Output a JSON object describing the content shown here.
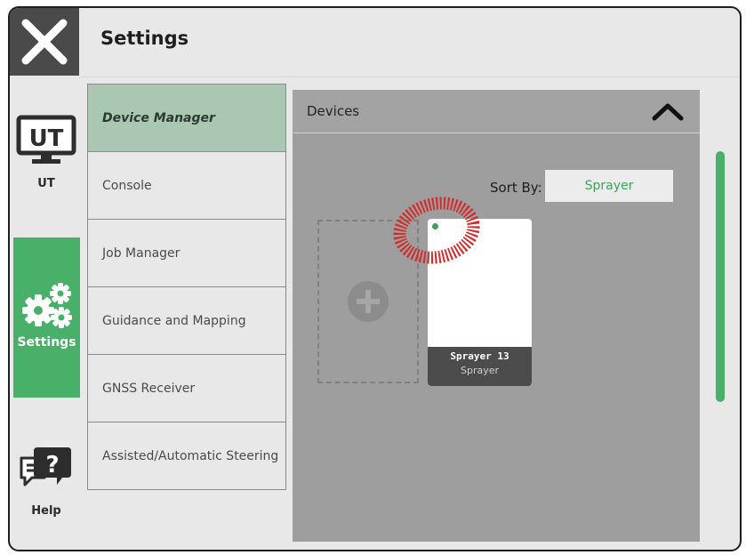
{
  "header": {
    "title": "Settings"
  },
  "sidebar": {
    "items": [
      {
        "label": "UT",
        "icon": "ut-monitor-icon"
      },
      {
        "label": "Settings",
        "icon": "gears-icon",
        "active": true
      },
      {
        "label": "Help",
        "icon": "help-chat-icon"
      }
    ]
  },
  "menu": {
    "items": [
      {
        "label": "Device Manager",
        "active": true
      },
      {
        "label": "Console"
      },
      {
        "label": "Job Manager"
      },
      {
        "label": "Guidance and Mapping"
      },
      {
        "label": "GNSS Receiver"
      },
      {
        "label": "Assisted/Automatic Steering"
      }
    ]
  },
  "devices": {
    "title": "Devices",
    "sort_label": "Sort By:",
    "sort_value": "Sprayer",
    "cards": [
      {
        "name": "Sprayer 13",
        "type": "Sprayer",
        "status_color": "#3aa35a"
      }
    ]
  },
  "colors": {
    "accent": "#49b06a",
    "active_menu": "#a9c7b1",
    "panel": "#9e9e9e"
  }
}
